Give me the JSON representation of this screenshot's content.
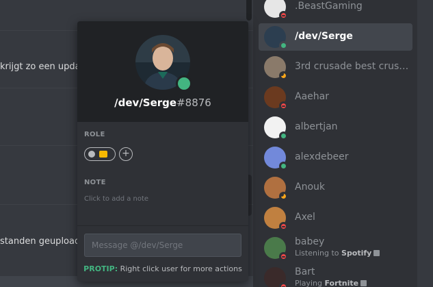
{
  "chat": {
    "snippet_1": "krijgt zo een upda",
    "snippet_2": "standen geupload"
  },
  "popout": {
    "username": "/dev/Serge",
    "discriminator": "#8876",
    "role_title": "ROLE",
    "add_role": "+",
    "note_title": "NOTE",
    "note_placeholder": "Click to add a note",
    "message_placeholder": "Message @/dev/Serge",
    "protip_label": "PROTIP:",
    "protip_text": " Right click user for more actions",
    "status_color": "#43b581"
  },
  "members": [
    {
      "name": ".BeastGaming",
      "status": "dnd",
      "avatar_color": "#e6e6e6"
    },
    {
      "name": "/dev/Serge",
      "status": "online",
      "avatar_color": "#2c3e50",
      "selected": true
    },
    {
      "name": "3rd crusade best crusa...",
      "status": "idle",
      "avatar_color": "#8a7a6a"
    },
    {
      "name": "Aaehar",
      "status": "dnd",
      "avatar_color": "#6b3a1f"
    },
    {
      "name": "albertjan",
      "status": "online",
      "avatar_color": "#f2f2f2"
    },
    {
      "name": "alexdebeer",
      "status": "online",
      "avatar_color": "#7289da"
    },
    {
      "name": "Anouk",
      "status": "idle",
      "avatar_color": "#b07040"
    },
    {
      "name": "Axel",
      "status": "dnd",
      "avatar_color": "#c08040"
    },
    {
      "name": "babey",
      "status": "dnd",
      "avatar_color": "#4a7a4a",
      "activity_prefix": "Listening to ",
      "activity_target": "Spotify"
    },
    {
      "name": "Bart",
      "status": "dnd",
      "avatar_color": "#3a2a2a",
      "activity_prefix": "Playing ",
      "activity_target": "Fortnite"
    }
  ],
  "colors": {
    "online": "#43b581",
    "dnd": "#f04747",
    "idle": "#faa61a",
    "background": "#36393f",
    "sidebar": "#2f3136"
  }
}
